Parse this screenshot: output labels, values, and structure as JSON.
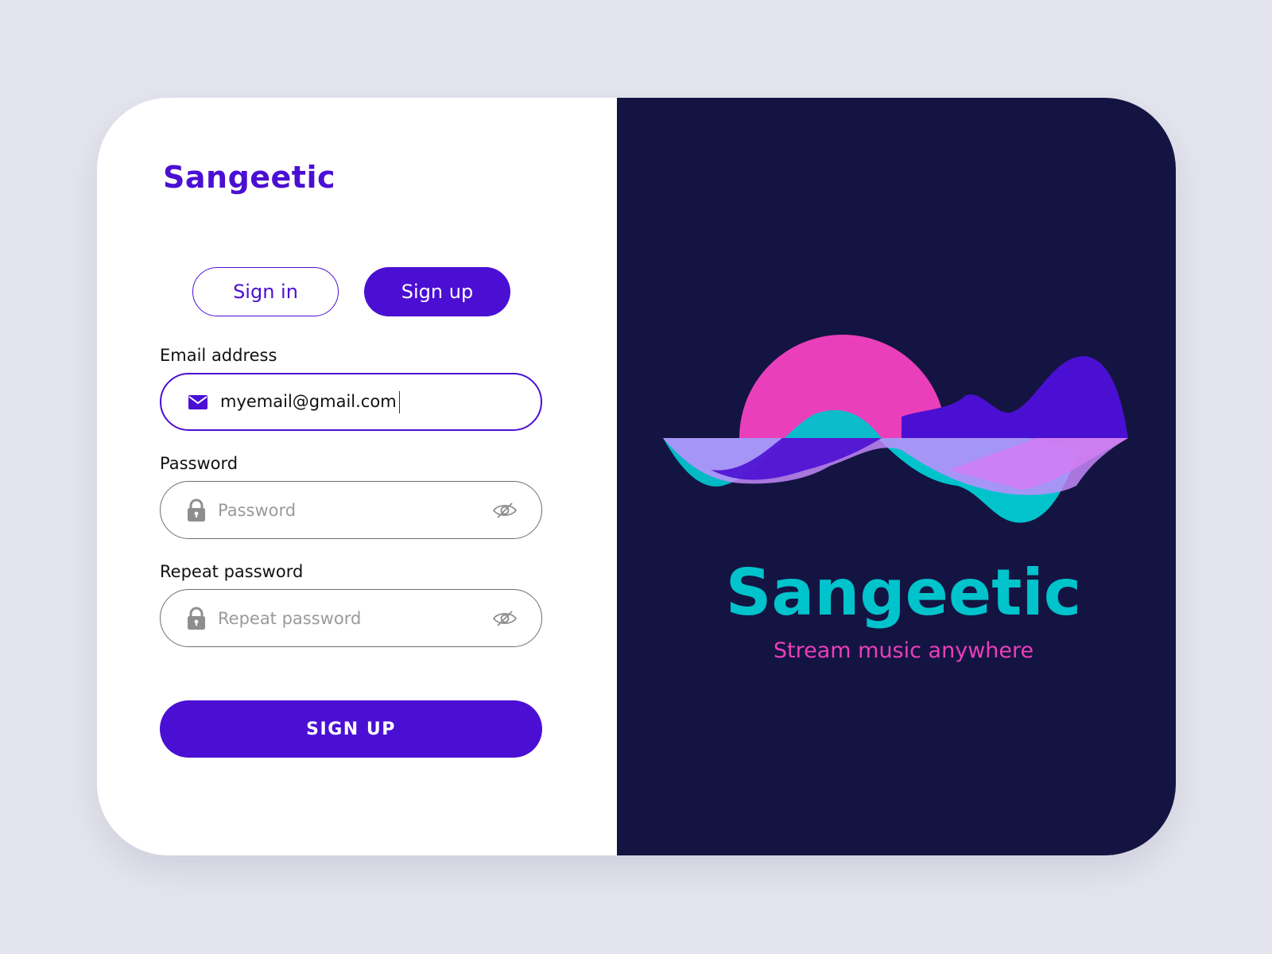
{
  "left_panel": {
    "brand": "Sangeetic",
    "tabs": {
      "sign_in": "Sign in",
      "sign_up": "Sign up",
      "active": "sign_up"
    },
    "email": {
      "label": "Email address",
      "value": "myemail@gmail.com",
      "icon": "envelope-icon"
    },
    "password": {
      "label": "Password",
      "placeholder": "Password",
      "icon": "lock-icon",
      "toggle_icon": "eye-off-icon"
    },
    "repeat_password": {
      "label": "Repeat password",
      "placeholder": "Repeat password",
      "icon": "lock-icon",
      "toggle_icon": "eye-off-icon"
    },
    "submit_label": "SIGN UP"
  },
  "right_panel": {
    "logo_title": "Sangeetic",
    "tagline": "Stream music anywhere"
  },
  "colors": {
    "page_background": "#e3e4ed",
    "accent": "#4b0fd3",
    "right_panel_background": "#141442",
    "logo_cyan": "#00c3cc",
    "logo_pink": "#ea3fba",
    "logo_lavender": "#c98cff"
  }
}
